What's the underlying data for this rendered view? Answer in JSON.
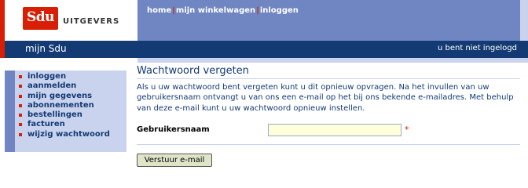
{
  "brand": {
    "logo": "Sdu",
    "subtitle": "UITGEVERS"
  },
  "topnav": {
    "home": "home",
    "cart": "mijn winkelwagen",
    "login": "inloggen"
  },
  "header": {
    "section": "mijn Sdu",
    "status": "u bent niet ingelogd"
  },
  "sidebar": {
    "items": [
      {
        "label": "inloggen"
      },
      {
        "label": "aanmelden"
      },
      {
        "label": "mijn gegevens"
      },
      {
        "label": "abonnementen"
      },
      {
        "label": "bestellingen"
      },
      {
        "label": "facturen"
      },
      {
        "label": "wijzig wachtwoord"
      }
    ]
  },
  "main": {
    "title": "Wachtwoord vergeten",
    "intro": "Als u uw wachtwoord bent vergeten kunt u dit opnieuw opvragen. Na het invullen van uw gebruikersnaam ontvangt u van ons een e-mail op het bij ons bekende e-mailadres. Met behulp van deze e-mail kunt u uw wachtwoord opnieuw instellen.",
    "username_label": "Gebruikersnaam",
    "username_value": "",
    "required_mark": "*",
    "submit_label": "Verstuur e-mail"
  },
  "colors": {
    "brand_red": "#d81e05",
    "navy": "#133a73",
    "nav_blue": "#6f86c2",
    "light_blue": "#c9d3ee"
  }
}
